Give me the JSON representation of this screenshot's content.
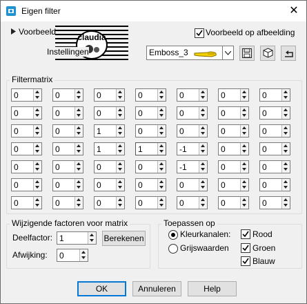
{
  "window": {
    "title": "Eigen filter",
    "close_glyph": "✕"
  },
  "preview": {
    "label": "Voorbeeld",
    "watermark_text": "claudia"
  },
  "settings": {
    "label": "Instellingen"
  },
  "preview_on_image": {
    "label": "Voorbeeld op afbeelding",
    "checked": true
  },
  "preset": {
    "value": "Emboss_3"
  },
  "filtermatrix": {
    "title": "Filtermatrix",
    "rows": [
      [
        "0",
        "0",
        "0",
        "0",
        "0",
        "0",
        "0"
      ],
      [
        "0",
        "0",
        "0",
        "0",
        "0",
        "0",
        "0"
      ],
      [
        "0",
        "0",
        "1",
        "0",
        "0",
        "0",
        "0"
      ],
      [
        "0",
        "0",
        "1",
        "1",
        "-1",
        "0",
        "0"
      ],
      [
        "0",
        "0",
        "0",
        "0",
        "-1",
        "0",
        "0"
      ],
      [
        "0",
        "0",
        "0",
        "0",
        "0",
        "0",
        "0"
      ],
      [
        "0",
        "0",
        "0",
        "0",
        "0",
        "0",
        "0"
      ]
    ]
  },
  "factors": {
    "title": "Wijzigende factoren voor matrix",
    "divisor_label": "Deelfactor:",
    "divisor_value": "1",
    "calculate_label": "Berekenen",
    "bias_label": "Afwijking:",
    "bias_value": "0"
  },
  "apply": {
    "title": "Toepassen op",
    "color_channels": "Kleurkanalen:",
    "greyscale": "Grijswaarden",
    "red": "Rood",
    "green": "Groen",
    "blue": "Blauw"
  },
  "footer": {
    "ok": "OK",
    "cancel": "Annuleren",
    "help": "Help"
  }
}
